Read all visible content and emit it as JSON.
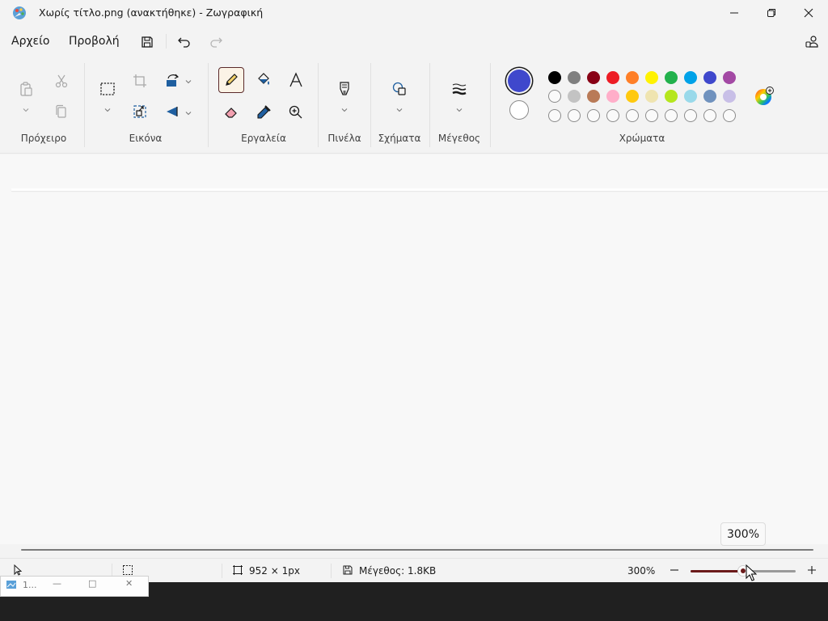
{
  "window": {
    "title": "Χωρίς τίτλο.png (ανακτήθηκε) - Ζωγραφική"
  },
  "menu": {
    "file": "Αρχείο",
    "view": "Προβολή"
  },
  "icons": {
    "app": "paint-palette-icon",
    "save": "save-icon",
    "undo": "undo-icon",
    "redo": "redo-icon",
    "share": "account-icon"
  },
  "ribbon": {
    "groups": {
      "clipboard": "Πρόχειρο",
      "image": "Εικόνα",
      "tools": "Εργαλεία",
      "brushes": "Πινέλα",
      "shapes": "Σχήματα",
      "size": "Μέγεθος",
      "colors": "Χρώματα"
    },
    "selected_tool": "pencil"
  },
  "colors": {
    "color1": "#3f48cc",
    "color2": "#ffffff",
    "row1": [
      "#000000",
      "#7f7f7f",
      "#880015",
      "#ed1c24",
      "#ff7f27",
      "#fff200",
      "#22b14c",
      "#00a2e8",
      "#3f48cc",
      "#a349a4"
    ],
    "row2": [
      "#ffffff",
      "#c3c3c3",
      "#b97a57",
      "#ffaec9",
      "#ffc90e",
      "#efe4b0",
      "#b5e61d",
      "#99d9ea",
      "#7092be",
      "#c8bfe7"
    ],
    "row3_empty_count": 10,
    "accent": "#6b1a1a"
  },
  "zoom": {
    "tooltip": "300%",
    "value": "300%",
    "fraction": 0.5
  },
  "status": {
    "canvas_size": "952 × 1px",
    "file_size": "Μέγεθος: 1.8KB"
  },
  "taskbar_thumb": {
    "label": "1..."
  }
}
